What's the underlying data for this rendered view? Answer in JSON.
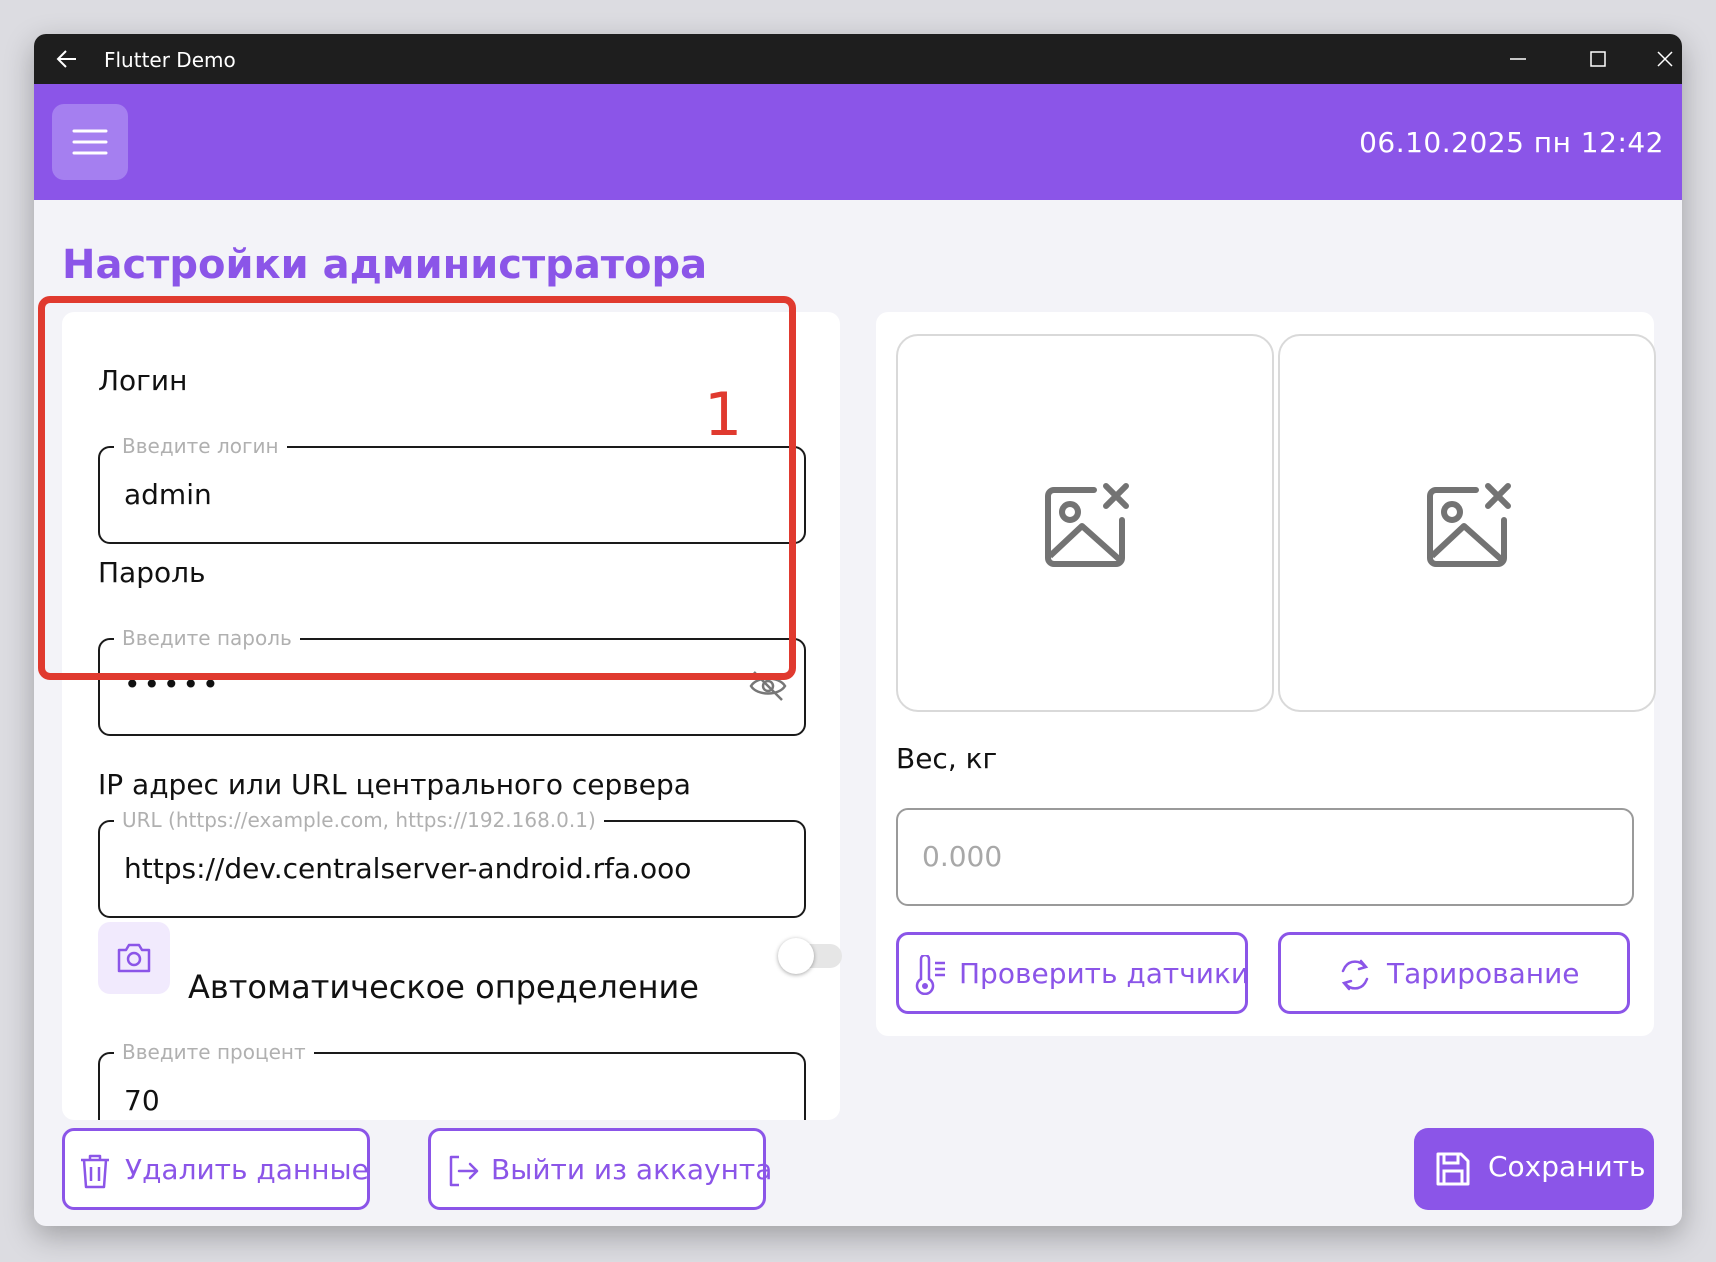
{
  "window": {
    "title": "Flutter Demo"
  },
  "appbar": {
    "datetime": "06.10.2025 пн 12:42"
  },
  "page": {
    "title": "Настройки администратора"
  },
  "login": {
    "label": "Логин",
    "placeholder": "Введите логин",
    "value": "admin"
  },
  "password": {
    "label": "Пароль",
    "placeholder": "Введите пароль",
    "value": "•••••"
  },
  "server": {
    "label": "IP адрес или URL центрального сервера",
    "placeholder": "URL (https://example.com, https://192.168.0.1)",
    "value": "https://dev.centralserver-android.rfa.ooo"
  },
  "auto_detect": {
    "label": "Автоматическое определение",
    "enabled": false
  },
  "percent": {
    "placeholder": "Введите процент",
    "value": "70"
  },
  "annotation": {
    "marker": "1"
  },
  "weight": {
    "label": "Вес, кг",
    "placeholder": "0.000"
  },
  "buttons": {
    "check_sensors": "Проверить датчики",
    "taring": "Тарирование",
    "delete_data": "Удалить данные",
    "logout": "Выйти из аккаунта",
    "save": "Сохранить"
  },
  "colors": {
    "accent": "#8b55e8",
    "highlight": "#e03a2f"
  }
}
